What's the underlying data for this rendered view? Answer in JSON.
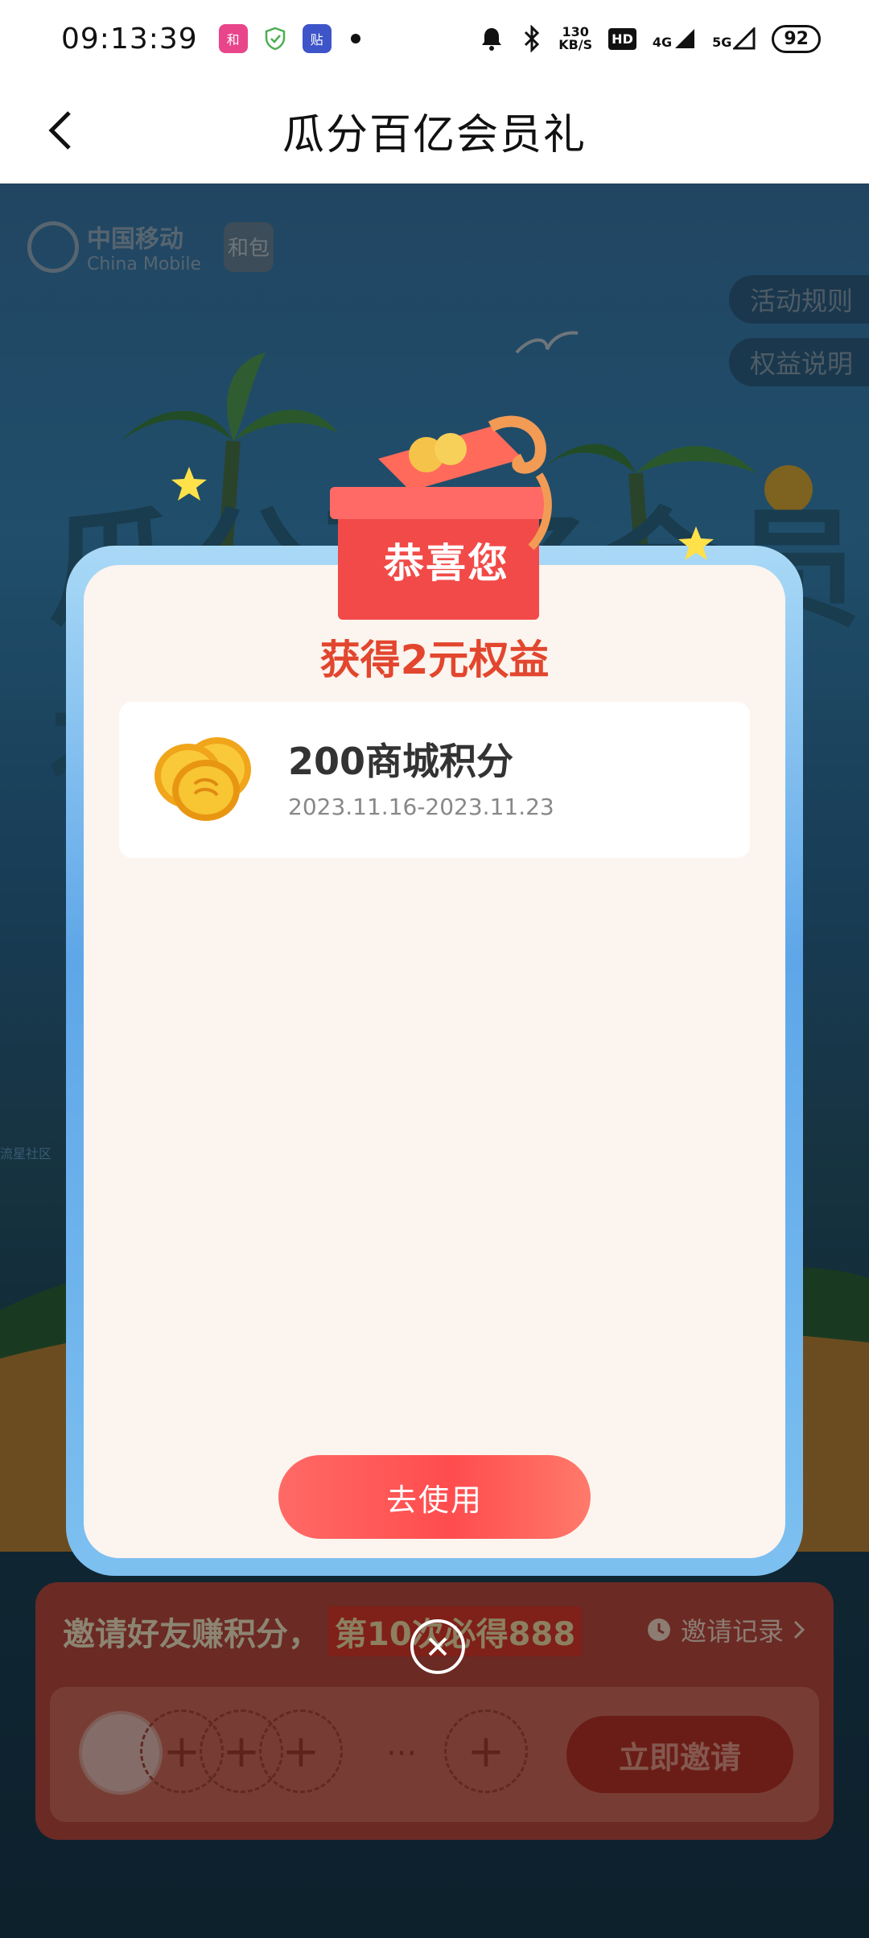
{
  "status_bar": {
    "time": "09:13:39",
    "app_icons": [
      "hebao-app-icon",
      "shield-check-icon",
      "tie-app-icon"
    ],
    "net_speed_value": "130",
    "net_speed_unit": "KB/S",
    "hd_label": "HD",
    "signal_4g": "4G",
    "signal_5g": "5G",
    "battery": "92"
  },
  "header": {
    "title": "瓜分百亿会员礼",
    "back_icon": "chevron-left-icon"
  },
  "background": {
    "brand_cn": "中国移动",
    "brand_en": "China Mobile",
    "hebao_badge": "和包",
    "side_buttons": [
      "活动规则",
      "权益说明"
    ],
    "community_link": "流星社区"
  },
  "modal": {
    "congrats": "恭喜您",
    "gain_title": "获得2元权益",
    "reward": {
      "name": "200商城积分",
      "validity": "2023.11.16-2023.11.23",
      "icon": "coins-icon"
    },
    "use_button": "去使用",
    "close_icon": "close-icon"
  },
  "invite_card": {
    "title": "邀请好友赚积分，",
    "highlight": "第10次必得888",
    "record_label": "邀请记录",
    "record_icon": "clock-icon",
    "invite_button": "立即邀请"
  },
  "colors": {
    "accent_red": "#e2462e",
    "button_red": "#ff4c4e",
    "modal_blue": "#5ea6e8",
    "modal_bg": "#fcf4ee"
  }
}
